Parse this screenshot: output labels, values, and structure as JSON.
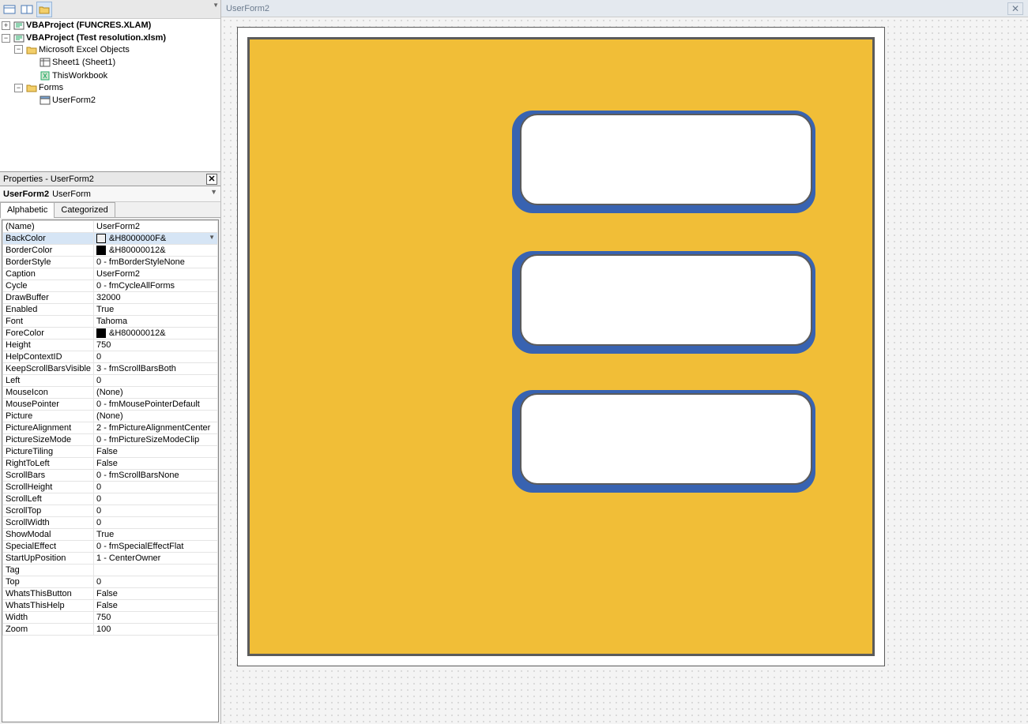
{
  "tree": {
    "project1": "VBAProject (FUNCRES.XLAM)",
    "project2": "VBAProject (Test resolution.xlsm)",
    "excel_objects": "Microsoft Excel Objects",
    "sheet1": "Sheet1 (Sheet1)",
    "thisworkbook": "ThisWorkbook",
    "forms": "Forms",
    "userform2": "UserForm2"
  },
  "props_title": "Properties - UserForm2",
  "objsel_name": "UserForm2",
  "objsel_type": "UserForm",
  "tabs": {
    "alphabetic": "Alphabetic",
    "categorized": "Categorized"
  },
  "properties": [
    {
      "k": "(Name)",
      "v": "UserForm2"
    },
    {
      "k": "BackColor",
      "v": "&H8000000F&",
      "swatch": "#f0f0f0",
      "selected": true
    },
    {
      "k": "BorderColor",
      "v": "&H80000012&",
      "swatch": "#000000"
    },
    {
      "k": "BorderStyle",
      "v": "0 - fmBorderStyleNone"
    },
    {
      "k": "Caption",
      "v": "UserForm2"
    },
    {
      "k": "Cycle",
      "v": "0 - fmCycleAllForms"
    },
    {
      "k": "DrawBuffer",
      "v": "32000"
    },
    {
      "k": "Enabled",
      "v": "True"
    },
    {
      "k": "Font",
      "v": "Tahoma"
    },
    {
      "k": "ForeColor",
      "v": "&H80000012&",
      "swatch": "#000000"
    },
    {
      "k": "Height",
      "v": "750"
    },
    {
      "k": "HelpContextID",
      "v": "0"
    },
    {
      "k": "KeepScrollBarsVisible",
      "v": "3 - fmScrollBarsBoth"
    },
    {
      "k": "Left",
      "v": "0"
    },
    {
      "k": "MouseIcon",
      "v": "(None)"
    },
    {
      "k": "MousePointer",
      "v": "0 - fmMousePointerDefault"
    },
    {
      "k": "Picture",
      "v": "(None)"
    },
    {
      "k": "PictureAlignment",
      "v": "2 - fmPictureAlignmentCenter"
    },
    {
      "k": "PictureSizeMode",
      "v": "0 - fmPictureSizeModeClip"
    },
    {
      "k": "PictureTiling",
      "v": "False"
    },
    {
      "k": "RightToLeft",
      "v": "False"
    },
    {
      "k": "ScrollBars",
      "v": "0 - fmScrollBarsNone"
    },
    {
      "k": "ScrollHeight",
      "v": "0"
    },
    {
      "k": "ScrollLeft",
      "v": "0"
    },
    {
      "k": "ScrollTop",
      "v": "0"
    },
    {
      "k": "ScrollWidth",
      "v": "0"
    },
    {
      "k": "ShowModal",
      "v": "True"
    },
    {
      "k": "SpecialEffect",
      "v": "0 - fmSpecialEffectFlat"
    },
    {
      "k": "StartUpPosition",
      "v": "1 - CenterOwner"
    },
    {
      "k": "Tag",
      "v": ""
    },
    {
      "k": "Top",
      "v": "0"
    },
    {
      "k": "WhatsThisButton",
      "v": "False"
    },
    {
      "k": "WhatsThisHelp",
      "v": "False"
    },
    {
      "k": "Width",
      "v": "750"
    },
    {
      "k": "Zoom",
      "v": "100"
    }
  ],
  "designer_title": "UserForm2"
}
